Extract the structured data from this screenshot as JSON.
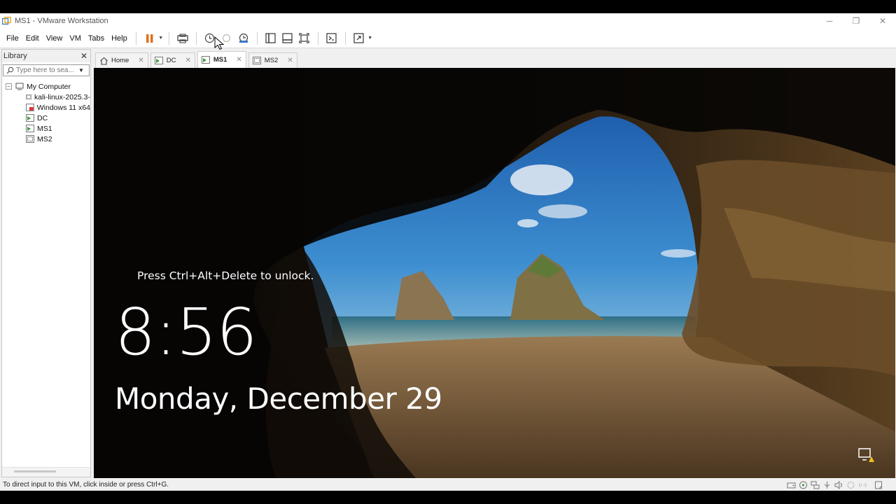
{
  "window": {
    "title": "MS1 - VMware Workstation",
    "controls": {
      "minimize": "─",
      "restore": "❐",
      "close": "✕"
    }
  },
  "menu": [
    "File",
    "Edit",
    "View",
    "VM",
    "Tabs",
    "Help"
  ],
  "toolbar": {
    "icons": [
      "pause-icon",
      "send-ctrl-alt-del-icon",
      "snapshot-icon",
      "revert-snapshot-icon",
      "snapshot-manager-icon",
      "show-library-icon",
      "thumbnail-bar-icon",
      "full-screen-icon",
      "console-view-icon",
      "stretch-guest-icon"
    ]
  },
  "library": {
    "title": "Library",
    "close": "✕",
    "search_placeholder": "Type here to sea...",
    "root": "My Computer",
    "items": [
      {
        "label": "kali-linux-2025.3-",
        "state": "off"
      },
      {
        "label": "Windows 11 x64",
        "state": "locked"
      },
      {
        "label": "DC",
        "state": "running"
      },
      {
        "label": "MS1",
        "state": "running"
      },
      {
        "label": "MS2",
        "state": "off"
      }
    ]
  },
  "tabs": [
    {
      "label": "Home",
      "close": "✕",
      "active": false
    },
    {
      "label": "DC",
      "close": "✕",
      "active": false
    },
    {
      "label": "MS1",
      "close": "✕",
      "active": true
    },
    {
      "label": "MS2",
      "close": "✕",
      "active": false
    }
  ],
  "lockscreen": {
    "hint": "Press Ctrl+Alt+Delete to unlock.",
    "time": "8:56",
    "date": "Monday, December 29"
  },
  "status": {
    "text": "To direct input to this VM, click inside or press Ctrl+G."
  },
  "colors": {
    "accent": "#e0701f",
    "running": "#3a9a3a",
    "sky": "#2a78c4"
  }
}
